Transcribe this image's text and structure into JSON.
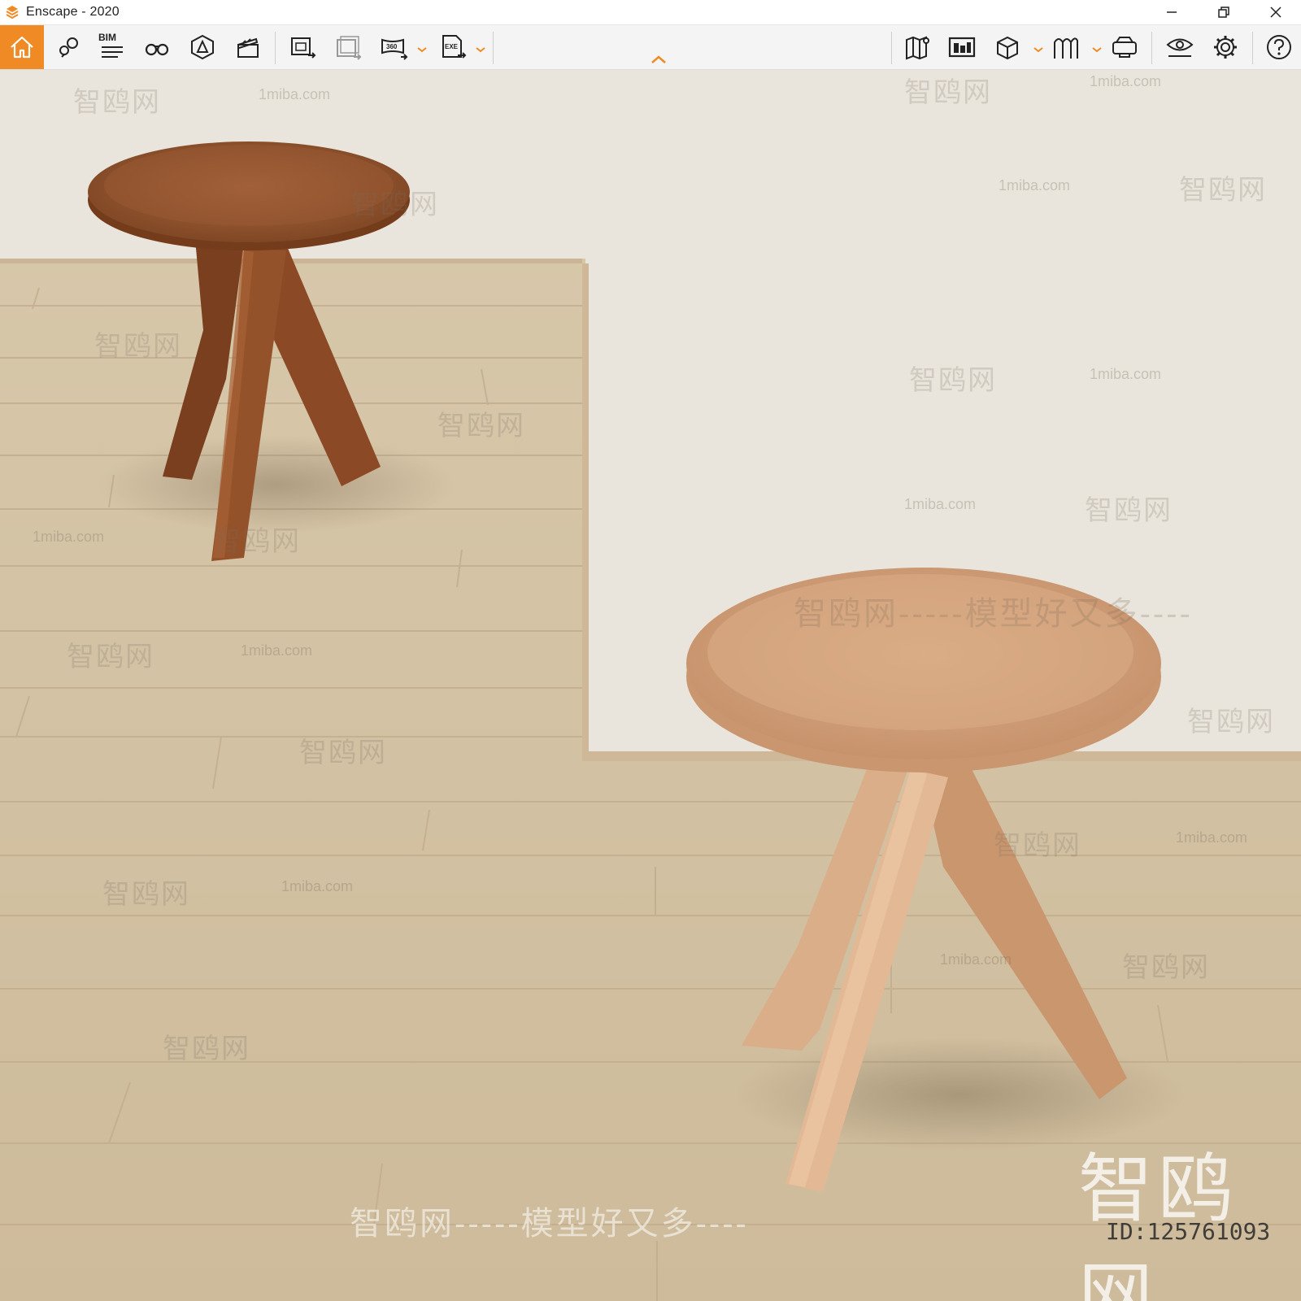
{
  "app": {
    "title": "Enscape - 2020",
    "accent_color": "#f08a24"
  },
  "window_controls": {
    "minimize_icon": "minimize-icon",
    "restore_icon": "restore-icon",
    "close_icon": "close-icon"
  },
  "toolbar": {
    "bim_label": "BIM",
    "left_tools": [
      {
        "name": "home",
        "icon": "home-icon"
      },
      {
        "name": "views",
        "icon": "map-pin-icon"
      },
      {
        "name": "bim",
        "icon": "bim-list-icon"
      },
      {
        "name": "binoculars",
        "icon": "binoculars-icon"
      },
      {
        "name": "atmosphere",
        "icon": "atmosphere-icon"
      },
      {
        "name": "video-editor",
        "icon": "clapperboard-icon"
      },
      {
        "name": "screenshot",
        "icon": "image-export-icon"
      },
      {
        "name": "batch-render",
        "icon": "batch-export-icon"
      },
      {
        "name": "panorama",
        "icon": "panorama-360-icon"
      },
      {
        "name": "exe-export",
        "icon": "exe-export-icon"
      }
    ],
    "right_tools": [
      {
        "name": "map",
        "icon": "map-icon"
      },
      {
        "name": "asset-library",
        "icon": "building-icon"
      },
      {
        "name": "cube",
        "icon": "cube-icon"
      },
      {
        "name": "vr",
        "icon": "vr-headset-icon"
      },
      {
        "name": "view-mode",
        "icon": "eye-icon"
      },
      {
        "name": "settings",
        "icon": "gear-icon"
      },
      {
        "name": "help",
        "icon": "help-icon"
      }
    ]
  },
  "watermarks": {
    "site_cn": "智鸥网",
    "site_url": "1miba.com",
    "slogan": "智鸥网-----模型好又多----",
    "big": "智鸥网",
    "id": "ID:125761093"
  }
}
